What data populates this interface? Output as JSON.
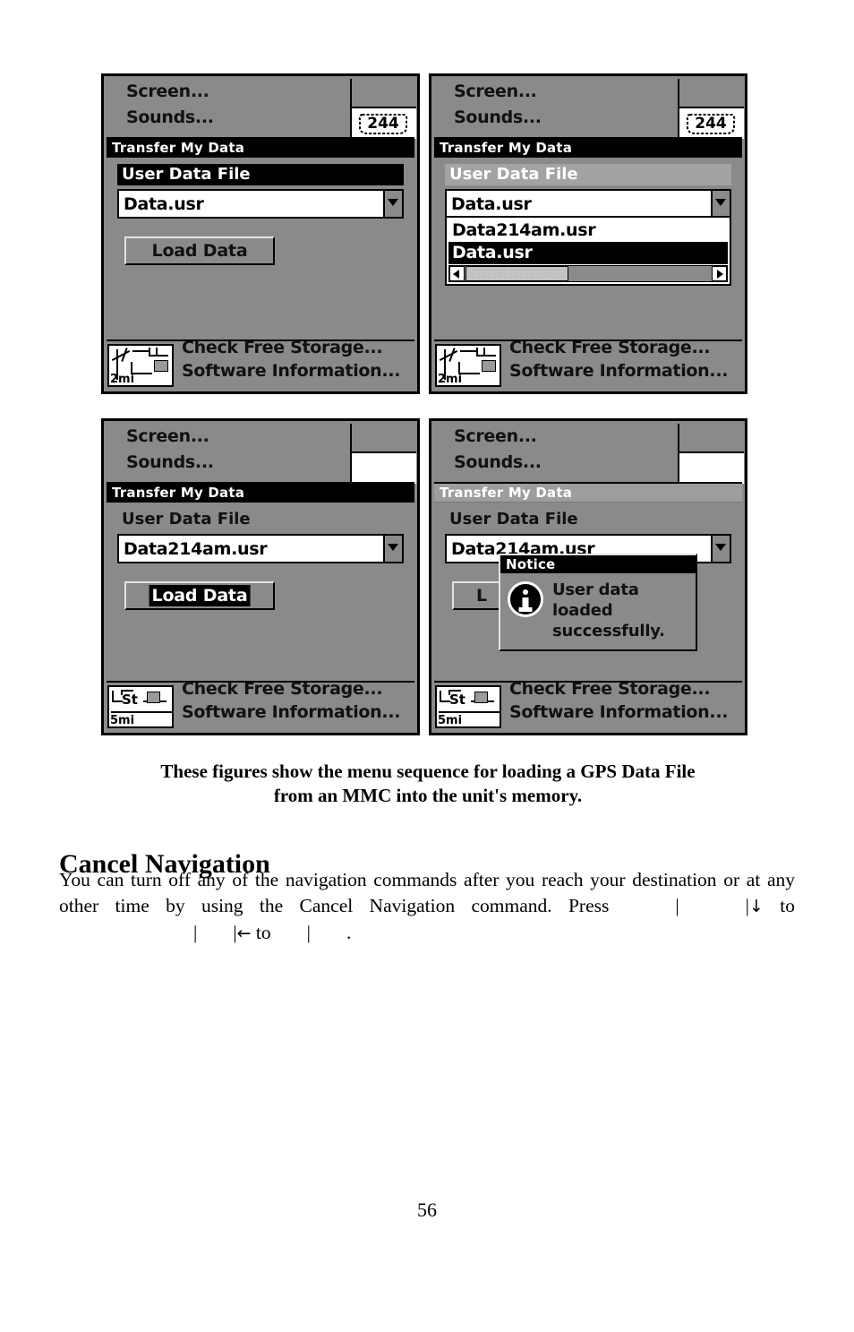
{
  "page": {
    "number": "56"
  },
  "figures": {
    "caption_line1": "These figures show the menu sequence for loading a GPS Data File",
    "caption_line2": "from an MMC into the unit's memory.",
    "panels": [
      {
        "id": "panel-1",
        "top_menu": {
          "item1": "Screen...",
          "item2": "Sounds..."
        },
        "status_icon": {
          "name": "highway-shield-244",
          "number": "244"
        },
        "dialog": {
          "title": "Transfer My Data",
          "title_state": "active",
          "field_label": "User Data File",
          "field_label_state": "selected",
          "combo_value": "Data.usr",
          "button_label": "Load Data",
          "button_state": "normal"
        },
        "bottom_menu": {
          "item1": "Check Free Storage...",
          "item2": "Software Information..."
        },
        "map_thumb": {
          "scale": "2mi",
          "label": ""
        }
      },
      {
        "id": "panel-2",
        "top_menu": {
          "item1": "Screen...",
          "item2": "Sounds..."
        },
        "status_icon": {
          "name": "highway-shield-244",
          "number": "244"
        },
        "dialog": {
          "title": "Transfer My Data",
          "title_state": "active",
          "field_label": "User Data File",
          "field_label_state": "band",
          "combo_value": "Data.usr",
          "dropdown_open": true,
          "dropdown_items": [
            {
              "label": "Data214am.usr",
              "selected": false
            },
            {
              "label": "Data.usr",
              "selected": true
            }
          ]
        },
        "bottom_menu": {
          "item1": "Check Free Storage...",
          "item2": "Software Information..."
        },
        "map_thumb": {
          "scale": "2mi",
          "label": ""
        }
      },
      {
        "id": "panel-3",
        "top_menu": {
          "item1": "Screen...",
          "item2": "Sounds..."
        },
        "status_icon": {
          "name": "blank-white-box",
          "number": ""
        },
        "dialog": {
          "title": "Transfer My Data",
          "title_state": "active",
          "field_label": "User Data File",
          "field_label_state": "plain",
          "combo_value": "Data214am.usr",
          "button_label": "Load Data",
          "button_state": "selected"
        },
        "bottom_menu": {
          "item1": "Check Free Storage...",
          "item2": "Software Information..."
        },
        "map_thumb": {
          "scale": "5mi",
          "label": "St"
        }
      },
      {
        "id": "panel-4",
        "top_menu": {
          "item1": "Screen...",
          "item2": "Sounds..."
        },
        "status_icon": {
          "name": "blank-white-box",
          "number": ""
        },
        "dialog": {
          "title": "Transfer My Data",
          "title_state": "inactive",
          "field_label": "User Data File",
          "field_label_state": "plain",
          "combo_value": "Data214am.usr",
          "button_label": "L",
          "button_state": "normal"
        },
        "notice": {
          "title": "Notice",
          "icon": "info-icon",
          "line1": "User data loaded",
          "line2": "successfully."
        },
        "bottom_menu": {
          "item1": "Check Free Storage...",
          "item2": "Software Information..."
        },
        "map_thumb": {
          "scale": "5mi",
          "label": "St"
        }
      }
    ]
  },
  "content": {
    "heading": "Cancel Navigation",
    "para_part1": "You can turn off any of the navigation commands after you reach your destination or at any other time by using the Cancel Navigation command. Press",
    "key_pipe": "|",
    "arrow_down": "↓",
    "arrow_left": "←",
    "word_to": "to",
    "period": "."
  }
}
